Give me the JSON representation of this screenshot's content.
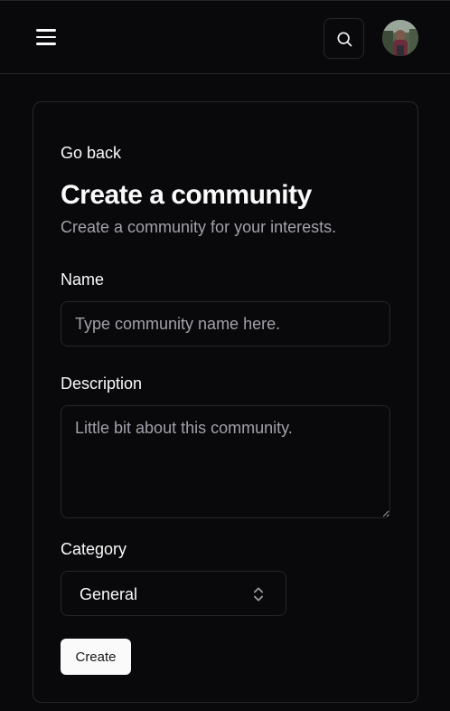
{
  "header": {
    "menu_icon": "hamburger-menu-icon",
    "search_icon": "search-icon",
    "avatar_icon": "user-avatar"
  },
  "page": {
    "go_back": "Go back",
    "title": "Create a community",
    "subtitle": "Create a community for your interests."
  },
  "form": {
    "name": {
      "label": "Name",
      "value": "",
      "placeholder": "Type community name here."
    },
    "description": {
      "label": "Description",
      "value": "",
      "placeholder": "Little bit about this community."
    },
    "category": {
      "label": "Category",
      "selected": "General",
      "icon": "chevron-up-down-icon"
    },
    "submit_label": "Create"
  },
  "colors": {
    "background": "#09090b",
    "border": "#27272a",
    "text": "#fafafa",
    "muted_text": "#a1a1aa",
    "button_bg": "#fafafa",
    "button_text": "#18181b"
  }
}
